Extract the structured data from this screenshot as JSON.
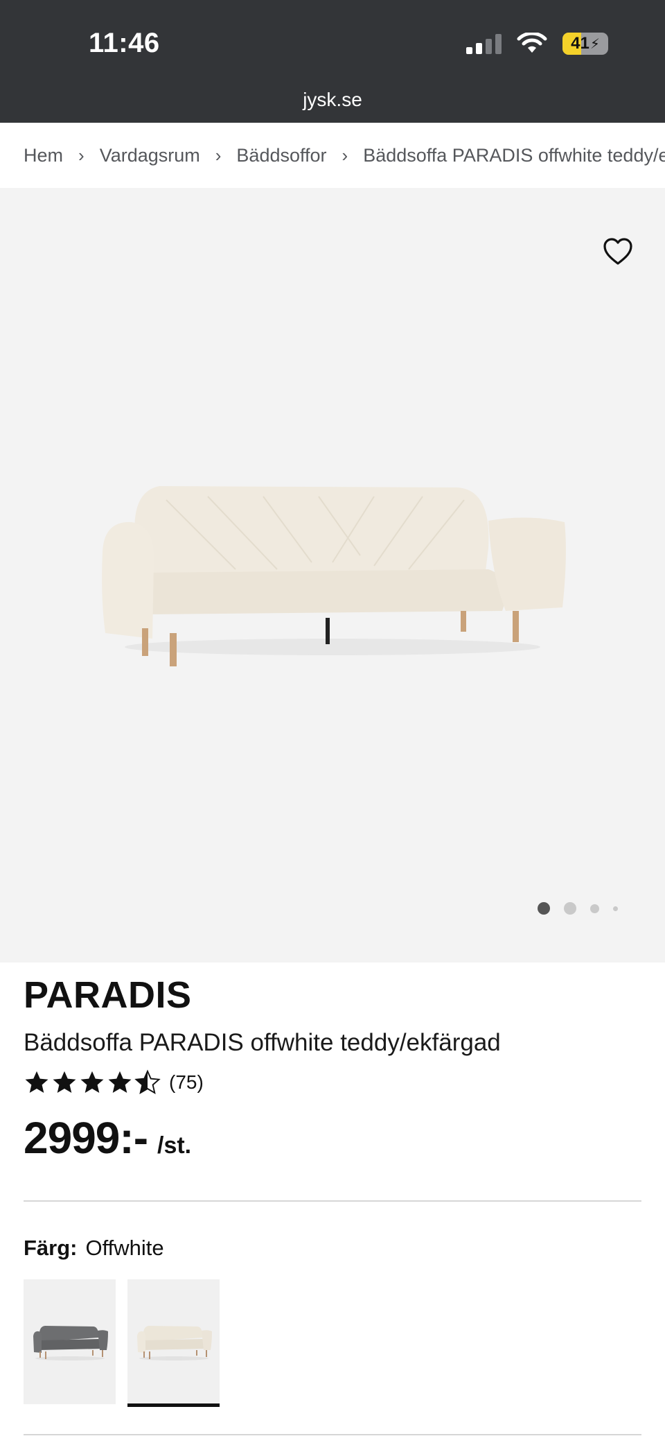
{
  "status_bar": {
    "time": "11:46",
    "battery": "41"
  },
  "browser": {
    "url": "jysk.se"
  },
  "breadcrumb": [
    "Hem",
    "Vardagsrum",
    "Bäddsoffor",
    "Bäddsoffa PARADIS offwhite teddy/ekfärgad"
  ],
  "gallery": {
    "dots_count": 4,
    "active_dot": 1,
    "image": "sofa-image"
  },
  "product": {
    "brand": "PARADIS",
    "name": "Bäddsoffa PARADIS offwhite teddy/ekfärgad",
    "rating": 4.5,
    "review_count": "(75)",
    "price": "2999:-",
    "unit": "/st."
  },
  "color": {
    "label": "Färg:",
    "value": "Offwhite",
    "swatches": [
      {
        "name": "Grå",
        "color": "#6d6e70",
        "selected": false
      },
      {
        "name": "Offwhite",
        "color": "#ece6d9",
        "selected": true
      }
    ]
  },
  "colors": {
    "status_bar_bg": "#333538",
    "gallery_bg": "#f3f3f3",
    "battery": "#f4d12a"
  }
}
